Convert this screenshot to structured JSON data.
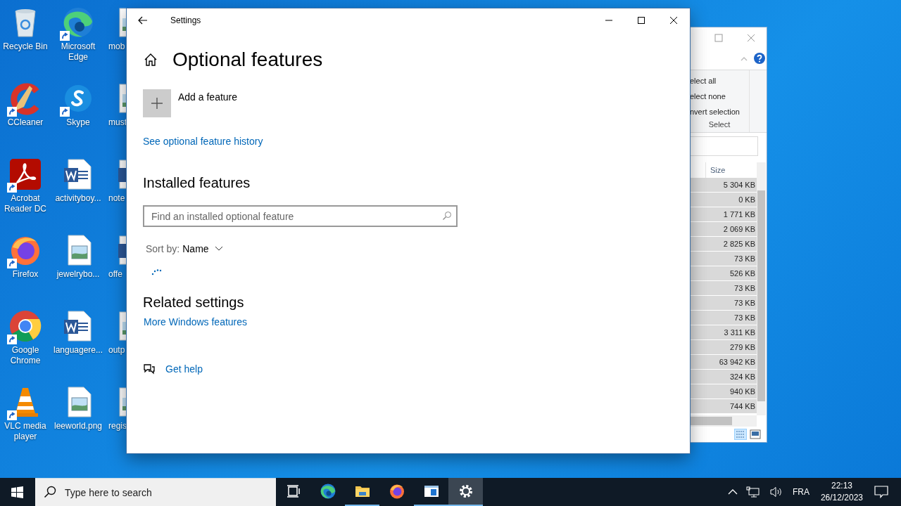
{
  "desktop": {
    "icons": [
      {
        "label": "Recycle Bin",
        "kind": "recycle",
        "shortcut": false
      },
      {
        "label": "CCleaner",
        "kind": "broom",
        "shortcut": true
      },
      {
        "label": "Acrobat Reader DC",
        "kind": "pdf",
        "shortcut": true
      },
      {
        "label": "Firefox",
        "kind": "firefox",
        "shortcut": true
      },
      {
        "label": "Google Chrome",
        "kind": "chrome",
        "shortcut": true
      },
      {
        "label": "VLC media player",
        "kind": "cone",
        "shortcut": true
      },
      {
        "label": "Microsoft Edge",
        "kind": "edge",
        "shortcut": true
      },
      {
        "label": "Skype",
        "kind": "chat",
        "shortcut": true
      },
      {
        "label": "activityboy...",
        "kind": "word",
        "shortcut": false
      },
      {
        "label": "jewelrybo...",
        "kind": "image",
        "shortcut": false
      },
      {
        "label": "languagere...",
        "kind": "word",
        "shortcut": false
      },
      {
        "label": "leeworld.png",
        "kind": "image",
        "shortcut": false
      },
      {
        "label": "mob",
        "kind": "image",
        "shortcut": false
      },
      {
        "label": "must",
        "kind": "image",
        "shortcut": false
      },
      {
        "label": "note",
        "kind": "word",
        "shortcut": false
      },
      {
        "label": "offe",
        "kind": "word",
        "shortcut": false
      },
      {
        "label": "outp",
        "kind": "image",
        "shortcut": false
      },
      {
        "label": "regis",
        "kind": "image",
        "shortcut": false
      }
    ]
  },
  "explorer": {
    "ribbon_items": [
      "elect all",
      "elect none",
      "nvert selection"
    ],
    "ribbon_group": "Select",
    "column": "Size",
    "rows": [
      {
        "size": "5 304 KB",
        "selected": true
      },
      {
        "size": "0 KB",
        "selected": true
      },
      {
        "size": "1 771 KB",
        "selected": true
      },
      {
        "size": "2 069 KB",
        "selected": true
      },
      {
        "size": "2 825 KB",
        "selected": true
      },
      {
        "size": "73 KB",
        "selected": true
      },
      {
        "size": "526 KB",
        "selected": true
      },
      {
        "size": "73 KB",
        "selected": true
      },
      {
        "size": "73 KB",
        "selected": true
      },
      {
        "size": "73 KB",
        "selected": true
      },
      {
        "size": "3 311 KB",
        "selected": true
      },
      {
        "size": "279 KB",
        "selected": true
      },
      {
        "size": "63 942 KB",
        "selected": true
      },
      {
        "size": "324 KB",
        "selected": true
      },
      {
        "size": "940 KB",
        "selected": true
      },
      {
        "size": "744 KB",
        "selected": true
      }
    ]
  },
  "settings": {
    "window_title": "Settings",
    "page_title": "Optional features",
    "add_button": "Add a feature",
    "history_link": "See optional feature history",
    "installed_heading": "Installed features",
    "search": {
      "placeholder": "Find an installed optional feature"
    },
    "sort_label": "Sort by:",
    "sort_value": "Name",
    "related_heading": "Related settings",
    "related_link": "More Windows features",
    "help_link": "Get help"
  },
  "taskbar": {
    "search": {
      "placeholder": "Type here to search"
    },
    "apps": [
      {
        "kind": "taskview",
        "running": false,
        "selected": false
      },
      {
        "kind": "edge",
        "running": false,
        "selected": false
      },
      {
        "kind": "folder",
        "running": true,
        "selected": false
      },
      {
        "kind": "firefox",
        "running": false,
        "selected": false
      },
      {
        "kind": "window",
        "running": true,
        "selected": false
      },
      {
        "kind": "gear",
        "running": true,
        "selected": true
      }
    ],
    "language": "FRA",
    "time": "22:13",
    "date": "26/12/2023"
  }
}
